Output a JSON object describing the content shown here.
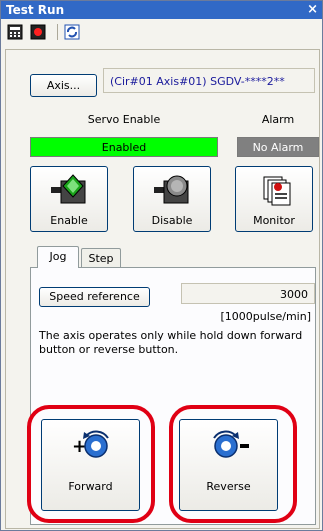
{
  "window": {
    "title": "Test Run",
    "close_glyph": "×"
  },
  "toolbar": {
    "icons": [
      "calculator-icon",
      "record-icon",
      "refresh-icon"
    ]
  },
  "axis": {
    "button_label": "Axis...",
    "info": "(Cir#01 Axis#01) SGDV-****2**"
  },
  "servo": {
    "header": "Servo Enable",
    "status": "Enabled",
    "status_color": "#00ff00"
  },
  "alarm": {
    "header": "Alarm",
    "status": "No Alarm",
    "status_color": "#808080"
  },
  "buttons": {
    "enable": "Enable",
    "disable": "Disable",
    "monitor": "Monitor"
  },
  "tabs": [
    {
      "label": "Jog",
      "active": true
    },
    {
      "label": "Step",
      "active": false
    }
  ],
  "jog": {
    "speed_button": "Speed reference",
    "speed_value": "3000",
    "unit": "[1000pulse/min]",
    "description": "The axis operates only while hold down forward button or reverse button.",
    "forward": "Forward",
    "reverse": "Reverse"
  },
  "colors": {
    "titlebar": "#3169c6",
    "highlight_ring": "#e00014"
  }
}
